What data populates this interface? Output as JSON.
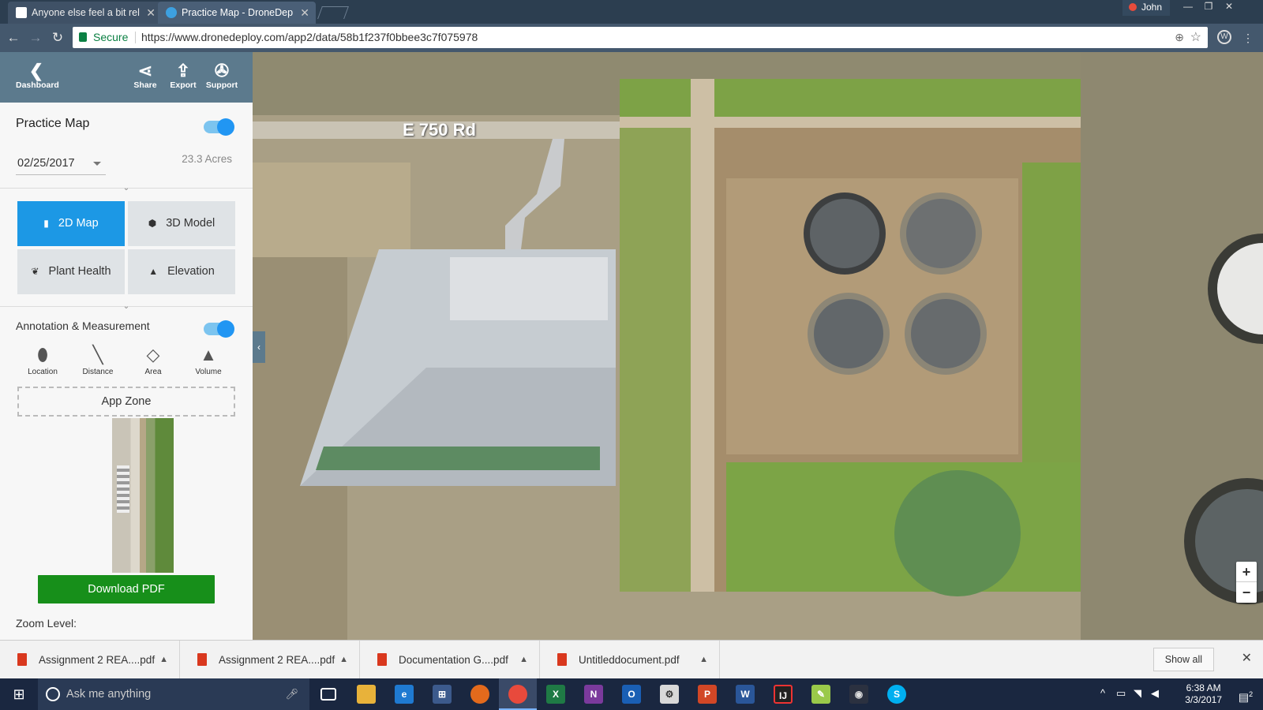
{
  "browser": {
    "tabs": [
      {
        "title": "Anyone else feel a bit rel"
      },
      {
        "title": "Practice Map - DroneDep"
      }
    ],
    "user": "John",
    "secure_label": "Secure",
    "url": "https://www.dronedeploy.com/app2/data/58b1f237f0bbee3c7f075978"
  },
  "sidebar": {
    "top": {
      "dashboard": "Dashboard",
      "share": "Share",
      "export": "Export",
      "support": "Support"
    },
    "map_title": "Practice Map",
    "map_visible": true,
    "date": "02/25/2017",
    "acres": "23.3 Acres",
    "views": [
      {
        "label": "2D Map",
        "active": true
      },
      {
        "label": "3D Model",
        "active": false
      },
      {
        "label": "Plant Health",
        "active": false
      },
      {
        "label": "Elevation",
        "active": false
      }
    ],
    "annotation_label": "Annotation & Measurement",
    "annotation_on": true,
    "tools": [
      {
        "label": "Location",
        "icon": "location-pin-icon"
      },
      {
        "label": "Distance",
        "icon": "distance-line-icon"
      },
      {
        "label": "Area",
        "icon": "area-polygon-icon"
      },
      {
        "label": "Volume",
        "icon": "volume-cone-icon"
      }
    ],
    "app_zone": "App Zone",
    "download_pdf": "Download PDF",
    "zoom_level": "Zoom Level:"
  },
  "map": {
    "road_label": "E 750 Rd",
    "zoom_in": "+",
    "zoom_out": "−"
  },
  "downloads": {
    "items": [
      {
        "name": "Assignment 2 REA....pdf"
      },
      {
        "name": "Assignment 2 REA....pdf"
      },
      {
        "name": "Documentation G....pdf"
      },
      {
        "name": "Untitleddocument.pdf"
      }
    ],
    "show_all": "Show all"
  },
  "taskbar": {
    "search_placeholder": "Ask me anything",
    "time": "6:38 AM",
    "date": "3/3/2017",
    "notification_count": "2"
  }
}
